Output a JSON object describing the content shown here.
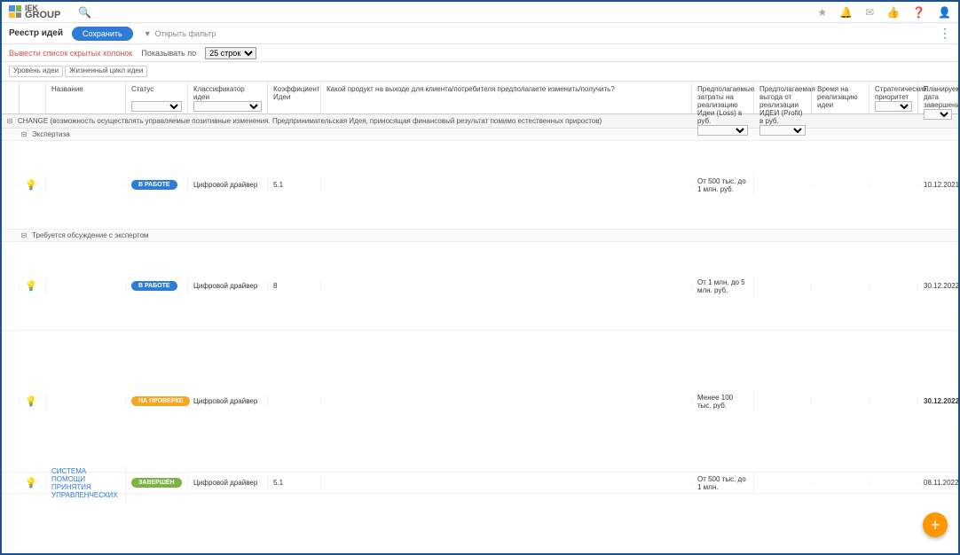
{
  "logo": {
    "line1": "IEK",
    "line2": "GROUP"
  },
  "toolbar": {
    "title": "Реестр идей",
    "save": "Сохранить",
    "filter": "Открыть фильтр"
  },
  "subbar": {
    "hidden_cols": "Вывести список скрытых колонок",
    "show_label": "Показывать по",
    "rows_option": "25 строк"
  },
  "chips": {
    "level": "Уровень идеи",
    "lifecycle": "Жизненный цикл идеи"
  },
  "columns": {
    "name": "Название",
    "status": "Статус",
    "class": "Классификатор идеи",
    "coef": "Коэффициент Идеи",
    "product": "Какой продукт на выходе для клиента/потребителя предполагаете изменить/получить?",
    "cost": "Предполагаемые затраты на реализацию Идеи (Loss) в руб.",
    "profit": "Предполагаемая выгода от реализации ИДЕИ (Profit) в руб.",
    "time": "Время на реализацию идеи",
    "strat": "Стратегический приоритет",
    "date": "Планируемая дата завершения"
  },
  "group": {
    "title": "CHANGE (возможность осуществлять управляемые позитивные изменения. Предпринимательская Идея, приносящая финансовый результат помимо естественных приростов)"
  },
  "subgroup1": {
    "title": "Экспертиза"
  },
  "subgroup2": {
    "title": "Требуется обсуждение с экспертом"
  },
  "rows": [
    {
      "name": "",
      "status": "В РАБОТЕ",
      "status_kind": "blue",
      "class": "Цифровой драйвер",
      "coef": "5.1",
      "cost": "От 500 тыс. до 1 млн. руб.",
      "date": "10.12.2021",
      "date_bold": false
    },
    {
      "name": "",
      "status": "В РАБОТЕ",
      "status_kind": "blue",
      "class": "Цифровой драйвер",
      "coef": "8",
      "cost": "От 1 млн. до 5 млн. руб.",
      "date": "30.12.2022",
      "date_bold": false
    },
    {
      "name": "",
      "status": "НА ПРОВЕРКЕ",
      "status_kind": "orange",
      "class": "Цифровой драйвер",
      "coef": "",
      "cost": "Менее 100 тыс. руб.",
      "date": "30.12.2022",
      "date_bold": true
    },
    {
      "name": "СИСТЕМА ПОМОЩИ ПРИНЯТИЯ УПРАВЛЕНЧЕСКИХ",
      "name_link": true,
      "status": "ЗАВЕРШЁН",
      "status_kind": "green",
      "class": "Цифровой драйвер",
      "coef": "5.1",
      "cost": "От 500 тыс. до 1 млн.",
      "date": "08.11.2022",
      "date_bold": false
    }
  ]
}
